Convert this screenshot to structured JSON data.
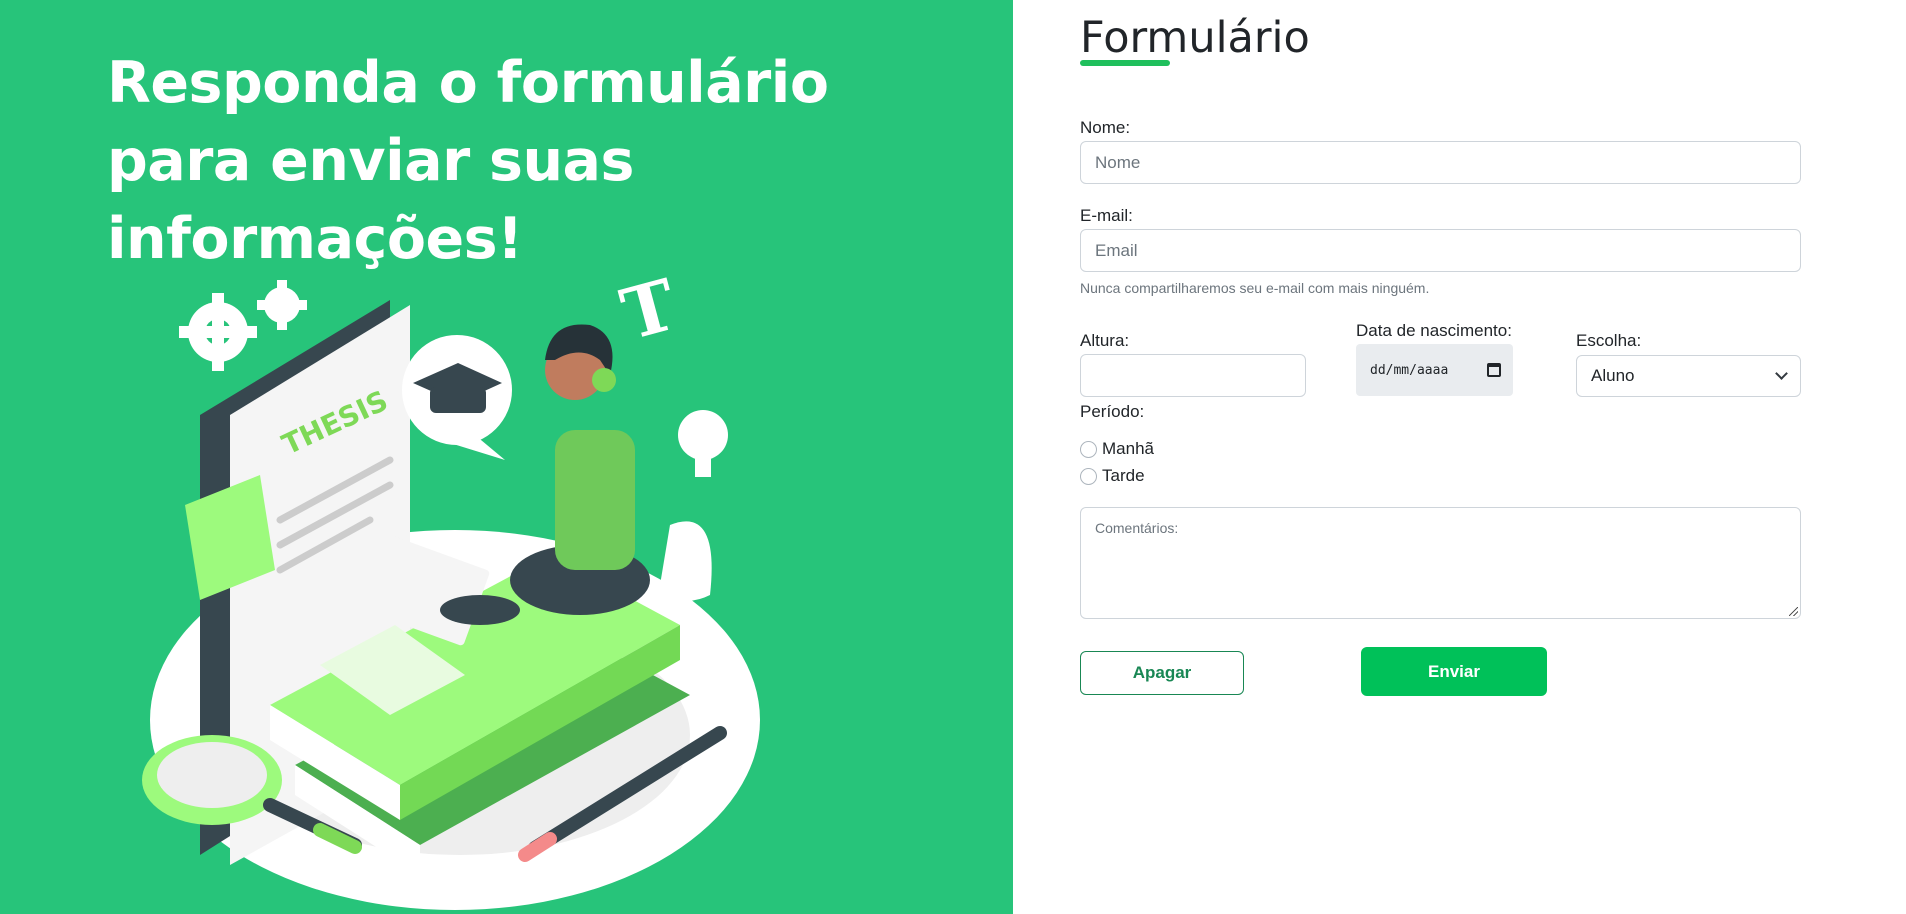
{
  "hero": {
    "title": "Responda o formulário para enviar suas informações!",
    "illustration_text": "THESIS",
    "illustration_letter": "T"
  },
  "form": {
    "title": "Formulário",
    "name": {
      "label": "Nome:",
      "placeholder": "Nome"
    },
    "email": {
      "label": "E-mail:",
      "placeholder": "Email",
      "help": "Nunca compartilharemos seu e-mail com mais ninguém."
    },
    "height": {
      "label": "Altura:",
      "value": ""
    },
    "birthdate": {
      "label": "Data de nascimento:",
      "value": "dd/mm/aaaa"
    },
    "choice": {
      "label": "Escolha:",
      "selected": "Aluno"
    },
    "period": {
      "label": "Período:",
      "options": [
        "Manhã",
        "Tarde"
      ]
    },
    "comments": {
      "placeholder": "Comentários:"
    },
    "buttons": {
      "clear": "Apagar",
      "submit": "Enviar"
    }
  },
  "colors": {
    "hero_bg": "#27c47a",
    "accent": "#00c159",
    "outline_button": "#198754"
  }
}
